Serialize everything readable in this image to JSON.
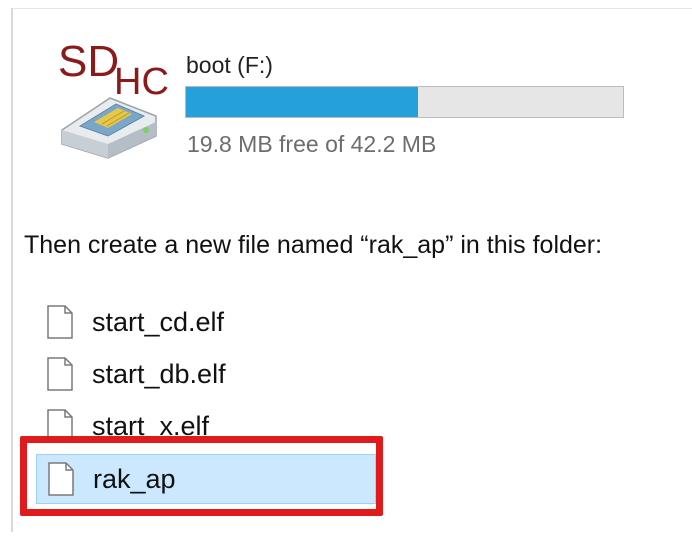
{
  "drive": {
    "logo_text": "SDHC",
    "name": "boot (F:)",
    "usage_fraction": 0.53,
    "free_text": "19.8 MB free of 42.2 MB",
    "icon": "sd-card-icon"
  },
  "instruction": "Then create a new file named “rak_ap” in this folder:",
  "files": [
    {
      "name": "start_cd.elf",
      "icon": "file-icon",
      "selected": false
    },
    {
      "name": "start_db.elf",
      "icon": "file-icon",
      "selected": false
    },
    {
      "name": "start_x.elf",
      "icon": "file-icon",
      "selected": false
    },
    {
      "name": "rak_ap",
      "icon": "file-icon",
      "selected": true
    }
  ],
  "colors": {
    "bar_fill": "#26a0da",
    "selection": "#cce8ff",
    "highlight": "#e01b1b",
    "logo": "#8b1a1a"
  }
}
